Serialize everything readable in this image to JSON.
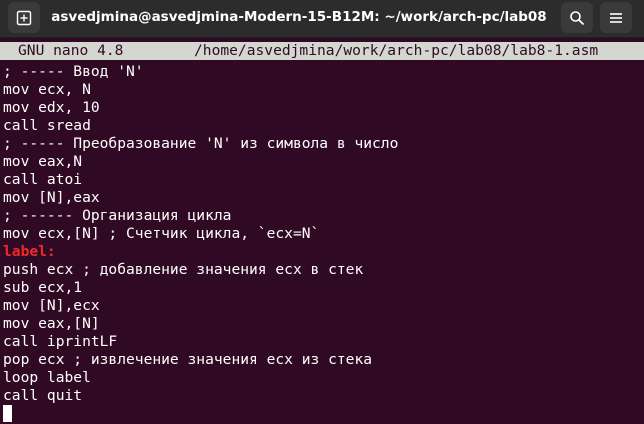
{
  "window": {
    "title": "asvedjmina@asvedjmina-Modern-15-B12M: ~/work/arch-pc/lab08",
    "new_tab_icon": "new-tab-icon",
    "search_icon": "search-icon",
    "menu_icon": "hamburger-menu-icon"
  },
  "nano": {
    "version": "GNU nano 4.8",
    "filepath": "/home/asvedjmina/work/arch-pc/lab08/lab8-1.asm"
  },
  "code_lines": [
    "; ----- Ввод 'N'",
    "mov ecx, N",
    "mov edx, 10",
    "call sread",
    "; ----- Преобразование 'N' из символа в число",
    "mov eax,N",
    "call atoi",
    "mov [N],eax",
    "; ------ Организация цикла",
    "mov ecx,[N] ; Счетчик цикла, `ecx=N`",
    "label:",
    "push ecx ; добавление значения ecx в стек",
    "sub ecx,1",
    "mov [N],ecx",
    "mov eax,[N]",
    "call iprintLF",
    "pop ecx ; извлечение значения ecx из стека",
    "loop label",
    "call quit",
    ""
  ],
  "colors": {
    "terminal_bg": "#300a24",
    "label_color": "#ef2929",
    "header_bg": "#d3d7cf"
  }
}
